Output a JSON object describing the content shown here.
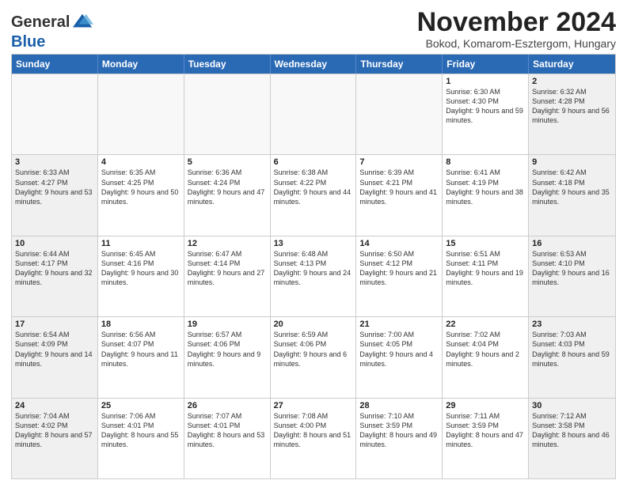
{
  "logo": {
    "general": "General",
    "blue": "Blue"
  },
  "header": {
    "month_title": "November 2024",
    "subtitle": "Bokod, Komarom-Esztergom, Hungary"
  },
  "days_of_week": [
    "Sunday",
    "Monday",
    "Tuesday",
    "Wednesday",
    "Thursday",
    "Friday",
    "Saturday"
  ],
  "weeks": [
    [
      {
        "day": "",
        "empty": true
      },
      {
        "day": "",
        "empty": true
      },
      {
        "day": "",
        "empty": true
      },
      {
        "day": "",
        "empty": true
      },
      {
        "day": "",
        "empty": true
      },
      {
        "day": "1",
        "sunrise": "Sunrise: 6:30 AM",
        "sunset": "Sunset: 4:30 PM",
        "daylight": "Daylight: 9 hours and 59 minutes."
      },
      {
        "day": "2",
        "sunrise": "Sunrise: 6:32 AM",
        "sunset": "Sunset: 4:28 PM",
        "daylight": "Daylight: 9 hours and 56 minutes."
      }
    ],
    [
      {
        "day": "3",
        "sunrise": "Sunrise: 6:33 AM",
        "sunset": "Sunset: 4:27 PM",
        "daylight": "Daylight: 9 hours and 53 minutes."
      },
      {
        "day": "4",
        "sunrise": "Sunrise: 6:35 AM",
        "sunset": "Sunset: 4:25 PM",
        "daylight": "Daylight: 9 hours and 50 minutes."
      },
      {
        "day": "5",
        "sunrise": "Sunrise: 6:36 AM",
        "sunset": "Sunset: 4:24 PM",
        "daylight": "Daylight: 9 hours and 47 minutes."
      },
      {
        "day": "6",
        "sunrise": "Sunrise: 6:38 AM",
        "sunset": "Sunset: 4:22 PM",
        "daylight": "Daylight: 9 hours and 44 minutes."
      },
      {
        "day": "7",
        "sunrise": "Sunrise: 6:39 AM",
        "sunset": "Sunset: 4:21 PM",
        "daylight": "Daylight: 9 hours and 41 minutes."
      },
      {
        "day": "8",
        "sunrise": "Sunrise: 6:41 AM",
        "sunset": "Sunset: 4:19 PM",
        "daylight": "Daylight: 9 hours and 38 minutes."
      },
      {
        "day": "9",
        "sunrise": "Sunrise: 6:42 AM",
        "sunset": "Sunset: 4:18 PM",
        "daylight": "Daylight: 9 hours and 35 minutes."
      }
    ],
    [
      {
        "day": "10",
        "sunrise": "Sunrise: 6:44 AM",
        "sunset": "Sunset: 4:17 PM",
        "daylight": "Daylight: 9 hours and 32 minutes."
      },
      {
        "day": "11",
        "sunrise": "Sunrise: 6:45 AM",
        "sunset": "Sunset: 4:16 PM",
        "daylight": "Daylight: 9 hours and 30 minutes."
      },
      {
        "day": "12",
        "sunrise": "Sunrise: 6:47 AM",
        "sunset": "Sunset: 4:14 PM",
        "daylight": "Daylight: 9 hours and 27 minutes."
      },
      {
        "day": "13",
        "sunrise": "Sunrise: 6:48 AM",
        "sunset": "Sunset: 4:13 PM",
        "daylight": "Daylight: 9 hours and 24 minutes."
      },
      {
        "day": "14",
        "sunrise": "Sunrise: 6:50 AM",
        "sunset": "Sunset: 4:12 PM",
        "daylight": "Daylight: 9 hours and 21 minutes."
      },
      {
        "day": "15",
        "sunrise": "Sunrise: 6:51 AM",
        "sunset": "Sunset: 4:11 PM",
        "daylight": "Daylight: 9 hours and 19 minutes."
      },
      {
        "day": "16",
        "sunrise": "Sunrise: 6:53 AM",
        "sunset": "Sunset: 4:10 PM",
        "daylight": "Daylight: 9 hours and 16 minutes."
      }
    ],
    [
      {
        "day": "17",
        "sunrise": "Sunrise: 6:54 AM",
        "sunset": "Sunset: 4:09 PM",
        "daylight": "Daylight: 9 hours and 14 minutes."
      },
      {
        "day": "18",
        "sunrise": "Sunrise: 6:56 AM",
        "sunset": "Sunset: 4:07 PM",
        "daylight": "Daylight: 9 hours and 11 minutes."
      },
      {
        "day": "19",
        "sunrise": "Sunrise: 6:57 AM",
        "sunset": "Sunset: 4:06 PM",
        "daylight": "Daylight: 9 hours and 9 minutes."
      },
      {
        "day": "20",
        "sunrise": "Sunrise: 6:59 AM",
        "sunset": "Sunset: 4:06 PM",
        "daylight": "Daylight: 9 hours and 6 minutes."
      },
      {
        "day": "21",
        "sunrise": "Sunrise: 7:00 AM",
        "sunset": "Sunset: 4:05 PM",
        "daylight": "Daylight: 9 hours and 4 minutes."
      },
      {
        "day": "22",
        "sunrise": "Sunrise: 7:02 AM",
        "sunset": "Sunset: 4:04 PM",
        "daylight": "Daylight: 9 hours and 2 minutes."
      },
      {
        "day": "23",
        "sunrise": "Sunrise: 7:03 AM",
        "sunset": "Sunset: 4:03 PM",
        "daylight": "Daylight: 8 hours and 59 minutes."
      }
    ],
    [
      {
        "day": "24",
        "sunrise": "Sunrise: 7:04 AM",
        "sunset": "Sunset: 4:02 PM",
        "daylight": "Daylight: 8 hours and 57 minutes."
      },
      {
        "day": "25",
        "sunrise": "Sunrise: 7:06 AM",
        "sunset": "Sunset: 4:01 PM",
        "daylight": "Daylight: 8 hours and 55 minutes."
      },
      {
        "day": "26",
        "sunrise": "Sunrise: 7:07 AM",
        "sunset": "Sunset: 4:01 PM",
        "daylight": "Daylight: 8 hours and 53 minutes."
      },
      {
        "day": "27",
        "sunrise": "Sunrise: 7:08 AM",
        "sunset": "Sunset: 4:00 PM",
        "daylight": "Daylight: 8 hours and 51 minutes."
      },
      {
        "day": "28",
        "sunrise": "Sunrise: 7:10 AM",
        "sunset": "Sunset: 3:59 PM",
        "daylight": "Daylight: 8 hours and 49 minutes."
      },
      {
        "day": "29",
        "sunrise": "Sunrise: 7:11 AM",
        "sunset": "Sunset: 3:59 PM",
        "daylight": "Daylight: 8 hours and 47 minutes."
      },
      {
        "day": "30",
        "sunrise": "Sunrise: 7:12 AM",
        "sunset": "Sunset: 3:58 PM",
        "daylight": "Daylight: 8 hours and 46 minutes."
      }
    ]
  ]
}
